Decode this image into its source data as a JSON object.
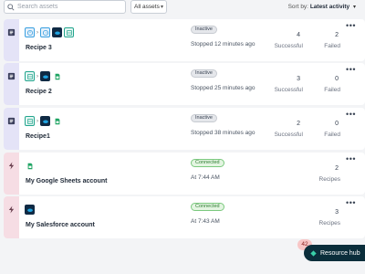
{
  "toolbar": {
    "search_placeholder": "Search assets",
    "filter_value": "All assets",
    "sort_prefix": "Sort by:",
    "sort_value": "Latest activity"
  },
  "items": [
    {
      "kind": "recipe",
      "name": "Recipe 3",
      "status_badge": "Inactive",
      "status_text": "Stopped 12 minutes ago",
      "metric1_value": "4",
      "metric1_label": "Successful",
      "metric2_value": "2",
      "metric2_label": "Failed",
      "apps": [
        "timer-icon",
        "timer-icon",
        "salesforce-icon",
        "table-icon"
      ]
    },
    {
      "kind": "recipe",
      "name": "Recipe 2",
      "status_badge": "Inactive",
      "status_text": "Stopped 25 minutes ago",
      "metric1_value": "3",
      "metric1_label": "Successful",
      "metric2_value": "0",
      "metric2_label": "Failed",
      "apps": [
        "table-icon",
        "salesforce-icon",
        "google-sheets-icon"
      ]
    },
    {
      "kind": "recipe",
      "name": "Recipe1",
      "status_badge": "Inactive",
      "status_text": "Stopped 38 minutes ago",
      "metric1_value": "2",
      "metric1_label": "Successful",
      "metric2_value": "0",
      "metric2_label": "Failed",
      "apps": [
        "table-icon",
        "salesforce-icon",
        "google-sheets-icon"
      ]
    },
    {
      "kind": "connection",
      "name": "My Google Sheets account",
      "status_badge": "Connected",
      "status_text": "At 7:44 AM",
      "metric2_value": "2",
      "metric2_label": "Recipes",
      "apps": [
        "google-sheets-icon"
      ]
    },
    {
      "kind": "connection",
      "name": "My Salesforce account",
      "status_badge": "Connected",
      "status_text": "At 7:43 AM",
      "metric2_value": "3",
      "metric2_label": "Recipes",
      "apps": [
        "salesforce-icon"
      ]
    }
  ],
  "notification_count": "42",
  "resource_hub_label": "Resource hub",
  "colors": {
    "recipe_strip": "#e4e3f7",
    "connection_strip": "#f6dde4",
    "connected_green": "#2f7d32",
    "hub_bg": "#0b2e3b"
  }
}
